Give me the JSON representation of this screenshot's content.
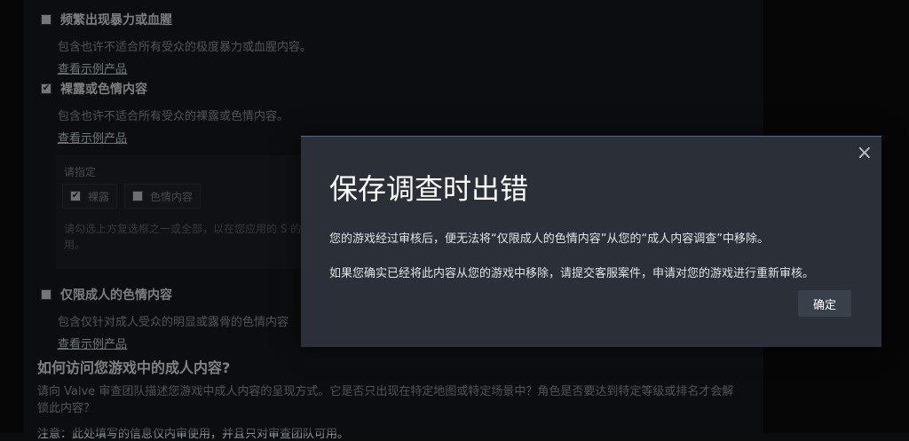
{
  "background": {
    "violence": {
      "label": "频繁出现暴力或血腥",
      "desc": "包含也许不适合所有受众的极度暴力或血腥内容。",
      "link": "查看示例产品",
      "checked": false
    },
    "nudity": {
      "label": "裸露或色情内容",
      "desc": "包含也许不适合所有受众的裸露或色情内容。",
      "link": "查看示例产品",
      "checked": true
    },
    "specify": {
      "title": "请指定",
      "chip1": "裸露",
      "chip1_checked": true,
      "chip2": "色情内容",
      "chip2_checked": false,
      "hint": "请勾选上方复选框之一或全部，以在您应用的 S 的应用。"
    },
    "adult_only": {
      "label": "仅限成人的色情内容",
      "desc": "包含仅针对成人受众的明显或露骨的色情内容",
      "link": "查看示例产品",
      "checked": false
    },
    "heading": "如何访问您游戏中的成人内容?",
    "para": "请向 Valve 审查团队描述您游戏中成人内容的呈现方式。它是否只出现在特定地图或特定场景中？角色是否要达到特定等级或排名才会解锁此内容？",
    "note": "注意：此处填写的信息仅内审使用，并且只对审查团队可用。"
  },
  "modal": {
    "title": "保存调查时出错",
    "line1": "您的游戏经过审核后，便无法将“仅限成人的色情内容”从您的“成人内容调查”中移除。",
    "line2": "如果您确实已经将此内容从您的游戏中移除，请提交客服案件，申请对您的游戏进行重新审核。",
    "ok_label": "确定",
    "close_glyph": "×"
  },
  "colors": {
    "accent": "#3b6bb8",
    "modal_bg": "#2a2f38",
    "page_bg": "#16191e"
  }
}
